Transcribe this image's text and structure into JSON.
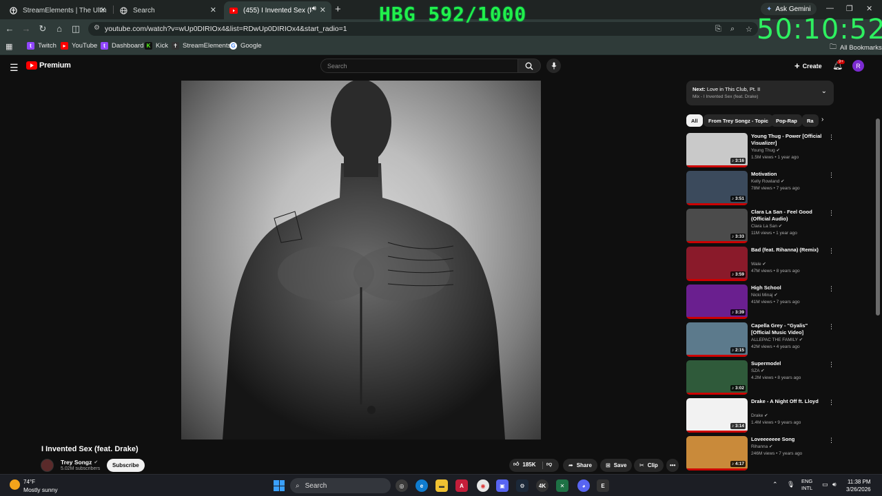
{
  "browser": {
    "tabs": [
      {
        "title": "StreamElements | The Ultimate",
        "icon": "streamelements-icon"
      },
      {
        "title": "Search",
        "icon": "globe-icon"
      },
      {
        "title": "(455) I Invented Sex (feat. D",
        "icon": "youtube-icon",
        "active": true
      }
    ],
    "ask_gemini": "Ask Gemini",
    "url": "youtube.com/watch?v=wUp0DIRIOx4&list=RDwUp0DIRIOx4&start_radio=1",
    "bookmarks": [
      {
        "label": "Twitch",
        "color": "#9146ff"
      },
      {
        "label": "YouTube",
        "color": "#ff0000"
      },
      {
        "label": "Dashboard",
        "color": "#9146ff"
      },
      {
        "label": "Kick",
        "color": "#53fc18"
      },
      {
        "label": "StreamElements",
        "color": "#ffffff"
      },
      {
        "label": "Google",
        "color": "#4285f4"
      }
    ],
    "all_bookmarks": "All Bookmarks"
  },
  "overlay": {
    "title": "HBG 592/1000",
    "timer": "50:10:52"
  },
  "youtube": {
    "logo_text": "Premium",
    "search_placeholder": "Search",
    "create_label": "Create",
    "notif_badge": "9+",
    "avatar_letter": "R",
    "video": {
      "title": "I Invented Sex (feat. Drake)",
      "channel": "Trey Songz",
      "subscribers": "5.02M subscribers",
      "subscribe_label": "Subscribe",
      "likes": "185K",
      "share_label": "Share",
      "save_label": "Save",
      "clip_label": "Clip"
    },
    "up_next": {
      "label": "Next:",
      "title": "Love in This Club, Pt. II",
      "mix": "Mix - I Invented Sex (feat. Drake)"
    },
    "chips": [
      "All",
      "From Trey Songz - Topic",
      "Pop-Rap",
      "Ra"
    ],
    "recommendations": [
      {
        "title": "Young Thug - Power [Official Visualizer]",
        "channel": "Young Thug",
        "meta": "1.5M views • 1 year ago",
        "duration": "3:16",
        "verified": true,
        "color": "#c9c9c9"
      },
      {
        "title": "Motivation",
        "channel": "Kelly Rowland",
        "meta": "78M views • 7 years ago",
        "duration": "3:51",
        "verified": true,
        "color": "#3b4a5c"
      },
      {
        "title": "Clara La San - Feel Good (Official Audio)",
        "channel": "Clara La San",
        "meta": "11M views • 1 year ago",
        "duration": "3:33",
        "verified": true,
        "color": "#4b4b4b"
      },
      {
        "title": "Bad (feat. Rihanna) (Remix)",
        "channel": "Wale",
        "meta": "47M views • 8 years ago",
        "duration": "3:59",
        "verified": true,
        "color": "#8a1a2a"
      },
      {
        "title": "High School",
        "channel": "Nicki Minaj",
        "meta": "41M views • 7 years ago",
        "duration": "3:39",
        "verified": true,
        "color": "#6a1f8f"
      },
      {
        "title": "Capella Grey - \"Gyalis\" [Official Music Video]",
        "channel": "ALLEPAC THE FAMILY",
        "meta": "42M views • 4 years ago",
        "duration": "2:15",
        "verified": true,
        "color": "#5c7a8c"
      },
      {
        "title": "Supermodel",
        "channel": "SZA",
        "meta": "4.2M views • 8 years ago",
        "duration": "3:02",
        "verified": true,
        "color": "#2f5a3a"
      },
      {
        "title": "Drake - A Night Off ft. Lloyd",
        "channel": "Drake",
        "meta": "1.4M views • 9 years ago",
        "duration": "3:14",
        "verified": true,
        "color": "#f2f2f2"
      },
      {
        "title": "Loveeeeeee Song",
        "channel": "Rihanna",
        "meta": "246M views • 7 years ago",
        "duration": "4:17",
        "verified": true,
        "color": "#c98a3a"
      }
    ]
  },
  "taskbar": {
    "weather_temp": "74°F",
    "weather_desc": "Mostly sunny",
    "search_label": "Search",
    "lang_top": "ENG",
    "lang_bottom": "INTL",
    "time": "11:38 PM",
    "date": "3/26/2026",
    "discord_badge": "9+"
  }
}
